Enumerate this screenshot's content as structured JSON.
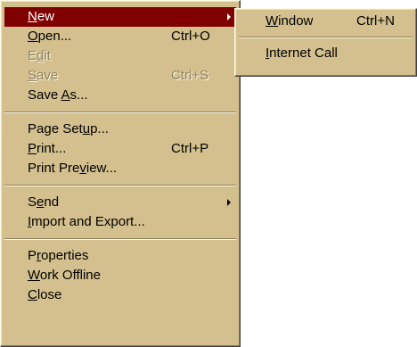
{
  "file_menu": {
    "new": {
      "prefix": "",
      "accel": "N",
      "suffix": "ew"
    },
    "open": {
      "prefix": "",
      "accel": "O",
      "suffix": "pen...",
      "shortcut": "Ctrl+O"
    },
    "edit": {
      "prefix": "E",
      "accel": "d",
      "suffix": "it"
    },
    "save": {
      "prefix": "",
      "accel": "S",
      "suffix": "ave",
      "shortcut": "Ctrl+S"
    },
    "save_as": {
      "prefix": "Save ",
      "accel": "A",
      "suffix": "s..."
    },
    "page_setup": {
      "prefix": "Page Set",
      "accel": "u",
      "suffix": "p..."
    },
    "print": {
      "prefix": "",
      "accel": "P",
      "suffix": "rint...",
      "shortcut": "Ctrl+P"
    },
    "print_preview": {
      "prefix": "Print Pre",
      "accel": "v",
      "suffix": "iew..."
    },
    "send": {
      "prefix": "S",
      "accel": "e",
      "suffix": "nd"
    },
    "import_export": {
      "prefix": "",
      "accel": "I",
      "suffix": "mport and Export..."
    },
    "properties": {
      "prefix": "P",
      "accel": "r",
      "suffix": "operties"
    },
    "work_offline": {
      "prefix": "",
      "accel": "W",
      "suffix": "ork Offline"
    },
    "close": {
      "prefix": "",
      "accel": "C",
      "suffix": "lose"
    }
  },
  "new_submenu": {
    "window": {
      "prefix": "",
      "accel": "W",
      "suffix": "indow",
      "shortcut": "Ctrl+N"
    },
    "internet_call": {
      "prefix": "",
      "accel": "I",
      "suffix": "nternet Call"
    }
  },
  "colors": {
    "menu_background": "#d4c08e",
    "highlight_background": "#800000",
    "highlight_text": "#ffffff",
    "disabled_text": "#8f8064"
  }
}
